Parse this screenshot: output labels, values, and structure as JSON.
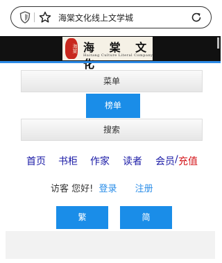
{
  "browser": {
    "page_title": "海棠文化线上文学城"
  },
  "banner": {
    "logo_chinese": "海 棠 文 化",
    "logo_english": "Haitang Culture Literal Company",
    "seal_text": "海棠"
  },
  "menu": {
    "menu_label": "菜单",
    "rank_label": "榜单",
    "search_label": "搜索"
  },
  "nav": {
    "home": "首页",
    "bookshelf": "书柜",
    "authors": "作家",
    "readers": "读者",
    "member": "会员",
    "slash": "/",
    "recharge": "充值"
  },
  "guest": {
    "greeting": "访客 您好!",
    "login": "登录",
    "register": "注册"
  },
  "lang": {
    "traditional": "繁",
    "simplified": "简"
  },
  "colors": {
    "accent_blue": "#1a8de8",
    "nav_blue": "#1a1aa6",
    "recharge_red": "#d4161b",
    "banner_black": "#111111"
  }
}
